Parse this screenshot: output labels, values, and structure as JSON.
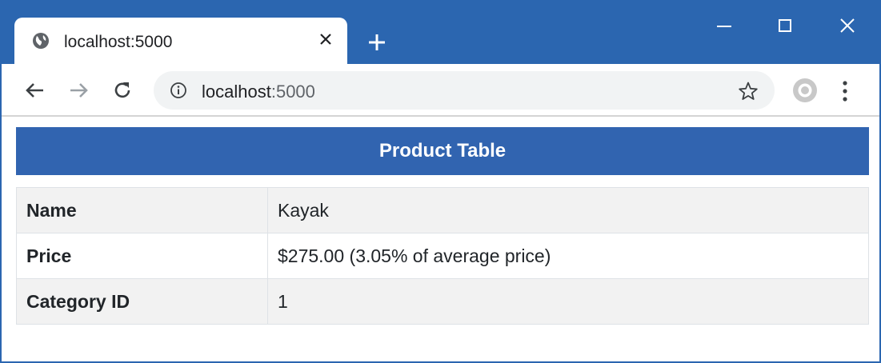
{
  "browser": {
    "tab_title": "localhost:5000",
    "url_host": "localhost",
    "url_port": ":5000",
    "colors": {
      "chrome": "#2b66b0",
      "omnibox": "#f1f3f4"
    },
    "icons": {
      "tab": "globe-icon",
      "tab_close": "close-icon",
      "new_tab": "plus-icon",
      "back": "back-arrow-icon",
      "forward": "forward-arrow-icon",
      "reload": "reload-icon",
      "info": "info-icon",
      "bookmark": "star-icon",
      "profile": "profile-icon",
      "menu": "kebab-menu-icon",
      "minimize": "minimize-icon",
      "maximize": "maximize-icon",
      "close": "window-close-icon"
    }
  },
  "page": {
    "header": "Product Table",
    "header_color": "#3164b0",
    "rows": [
      {
        "label": "Name",
        "value": "Kayak"
      },
      {
        "label": "Price",
        "value": "$275.00 (3.05% of average price)"
      },
      {
        "label": "Category ID",
        "value": "1"
      }
    ]
  }
}
